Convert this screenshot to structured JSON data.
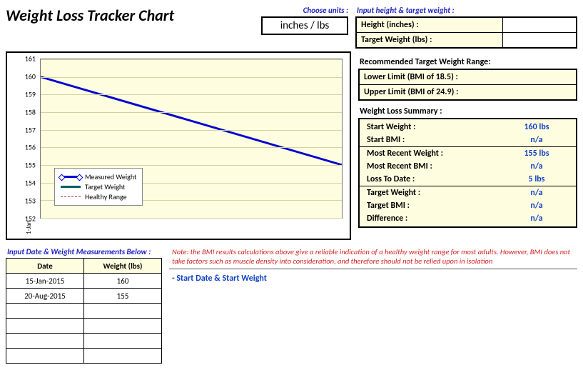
{
  "title": "Weight Loss Tracker Chart",
  "units": {
    "label": "Choose units :",
    "value": "inches / lbs"
  },
  "inputs": {
    "section": "Input height & target weight :",
    "height_label": "Height (inches) :",
    "height_value": "",
    "target_label": "Target Weight (lbs) :",
    "target_value": ""
  },
  "range": {
    "section": "Recommended Target Weight Range:",
    "lower_label": "Lower Limit (BMI of 18.5) :",
    "upper_label": "Upper Limit (BMI of 24.9) :"
  },
  "summary": {
    "section": "Weight Loss Summary :",
    "rows": [
      {
        "label": "Start Weight :",
        "value": "160 lbs"
      },
      {
        "label": "Start BMI :",
        "value": "n/a"
      },
      {
        "label": "Most Recent Weight :",
        "value": "155 lbs"
      },
      {
        "label": "Most Recent BMI :",
        "value": "n/a"
      },
      {
        "label": "Loss To Date :",
        "value": "5 lbs"
      },
      {
        "label": "Target Weight :",
        "value": "n/a"
      },
      {
        "label": "Target BMI :",
        "value": "n/a"
      },
      {
        "label": "Difference :",
        "value": "n/a"
      }
    ]
  },
  "chart_data": {
    "type": "line",
    "title": "",
    "xlabel": "",
    "ylabel": "",
    "ylim": [
      152,
      161
    ],
    "y_ticks": [
      152,
      153,
      154,
      155,
      156,
      157,
      158,
      159,
      160,
      161
    ],
    "x_ticks": [
      "1-Jan"
    ],
    "series": [
      {
        "name": "Measured Weight",
        "x": [
          "15-Jan-2015",
          "20-Aug-2015"
        ],
        "y": [
          160,
          155
        ],
        "color": "#0000d0"
      },
      {
        "name": "Target Weight",
        "x": [],
        "y": [],
        "color": "#006060"
      },
      {
        "name": "Healthy Range",
        "x": [],
        "y": [],
        "color": "#c04040",
        "style": "dashed"
      }
    ],
    "legend": [
      "Measured Weight",
      "Target Weight",
      "Healthy Range"
    ]
  },
  "measurements": {
    "section": "Input Date & Weight Measurements Below :",
    "headers": [
      "Date",
      "Weight (lbs)"
    ],
    "rows": [
      [
        "15-Jan-2015",
        "160"
      ],
      [
        "20-Aug-2015",
        "155"
      ],
      [
        "",
        ""
      ],
      [
        "",
        ""
      ],
      [
        "",
        ""
      ],
      [
        "",
        ""
      ]
    ]
  },
  "note": "Note: the BMI results calculations above give a reliable indication of a healthy weight range for most adults. However, BMI does not take factors such as muscle density into consideration, and therefore should not be relied upon in isolation",
  "start_arrow": "- Start Date & Start Weight"
}
